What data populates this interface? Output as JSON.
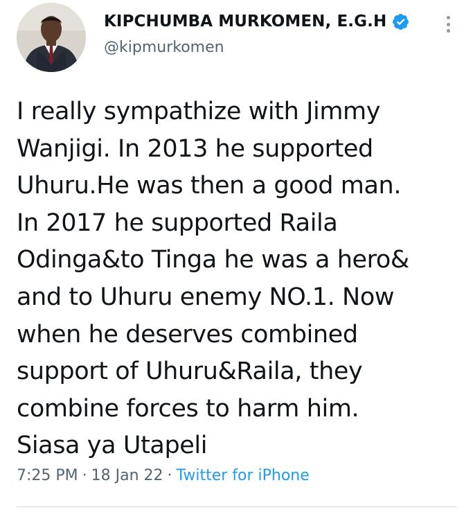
{
  "tweet": {
    "author": {
      "display_name": "KIPCHUMBA MURKOMEN, E.G.H",
      "handle": "@kipmurkomen",
      "verified": true,
      "avatar_icon": "profile-photo"
    },
    "text": "I really sympathize with Jimmy\nWanjigi. In 2013 he supported\nUhuru.He was then a good man.\nIn 2017 he supported Raila\nOdinga&to Tinga he was a hero&\nand to Uhuru enemy NO.1. Now\nwhen he deserves combined\nsupport of Uhuru&Raila, they\ncombine forces to harm him.\nSiasa ya Utapeli",
    "time": "7:25 PM",
    "separator": "·",
    "date": "18 Jan 22",
    "source": "Twitter for iPhone"
  },
  "colors": {
    "text": "#0f1419",
    "secondary": "#536471",
    "link": "#1d9bf0",
    "verified_badge": "#1d9bf0"
  },
  "icons": {
    "verified": "verified-badge-icon",
    "more": "more-options-icon"
  }
}
